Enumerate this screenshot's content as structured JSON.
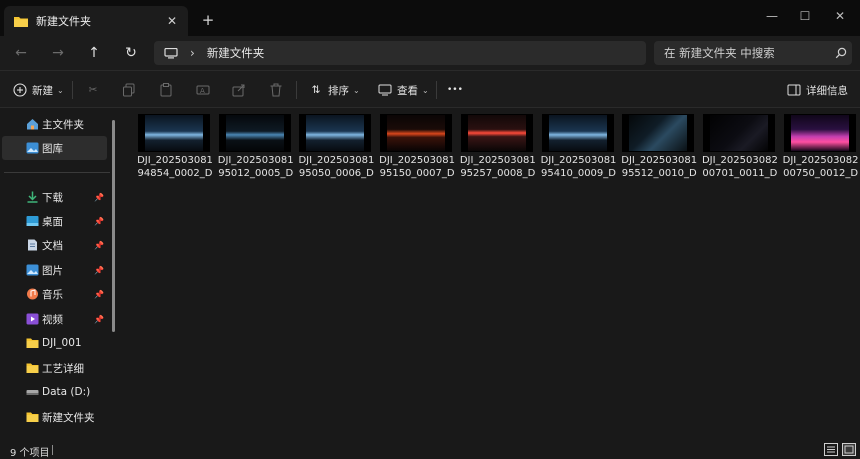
{
  "tab": {
    "title": "新建文件夹",
    "close": "✕",
    "new_tab": "+"
  },
  "window": {
    "minimize": "—",
    "maximize": "☐",
    "close": "✕"
  },
  "nav": {
    "back": "←",
    "forward": "→",
    "up": "↑",
    "refresh": "↻",
    "separator": "›",
    "breadcrumb": "新建文件夹",
    "search_placeholder": "在 新建文件夹 中搜索"
  },
  "toolbar": {
    "new_label": "新建",
    "sort_label": "排序",
    "view_label": "查看",
    "more": "•••",
    "details_label": "详细信息"
  },
  "sidebar": {
    "items": [
      {
        "label": "主文件夹",
        "icon": "home-icon"
      },
      {
        "label": "图库",
        "icon": "gallery-icon"
      },
      {
        "label": "下载",
        "icon": "download-icon",
        "pinned": true
      },
      {
        "label": "桌面",
        "icon": "desktop-icon",
        "pinned": true
      },
      {
        "label": "文档",
        "icon": "document-icon",
        "pinned": true
      },
      {
        "label": "图片",
        "icon": "pictures-icon",
        "pinned": true
      },
      {
        "label": "音乐",
        "icon": "music-icon",
        "pinned": true
      },
      {
        "label": "视频",
        "icon": "video-icon",
        "pinned": true
      },
      {
        "label": "DJI_001",
        "icon": "folder-icon"
      },
      {
        "label": "工艺详细",
        "icon": "folder-icon"
      },
      {
        "label": "Data (D:)",
        "icon": "drive-icon"
      },
      {
        "label": "新建文件夹",
        "icon": "folder-icon"
      }
    ]
  },
  "files": [
    {
      "name": "DJI_20250308194854_0002_D",
      "scene": "car-front-lights"
    },
    {
      "name": "DJI_20250308195012_0005_D",
      "scene": "car-front-dark"
    },
    {
      "name": "DJI_20250308195050_0006_D",
      "scene": "car-front-lights"
    },
    {
      "name": "DJI_20250308195150_0007_D",
      "scene": "car-tail-red"
    },
    {
      "name": "DJI_20250308195257_0008_D",
      "scene": "car-rear-red"
    },
    {
      "name": "DJI_20250308195410_0009_D",
      "scene": "car-front-lights"
    },
    {
      "name": "DJI_20250308195512_0010_D",
      "scene": "car-interior-screen"
    },
    {
      "name": "DJI_20250308200701_0011_D",
      "scene": "car-interior-dark"
    },
    {
      "name": "DJI_20250308200750_0012_D",
      "scene": "car-interior-pink"
    }
  ],
  "status": {
    "item_count": "9 个项目"
  },
  "colors": {
    "folder": "#f4c430",
    "accent": "#4aa3df",
    "background": "#191919"
  }
}
